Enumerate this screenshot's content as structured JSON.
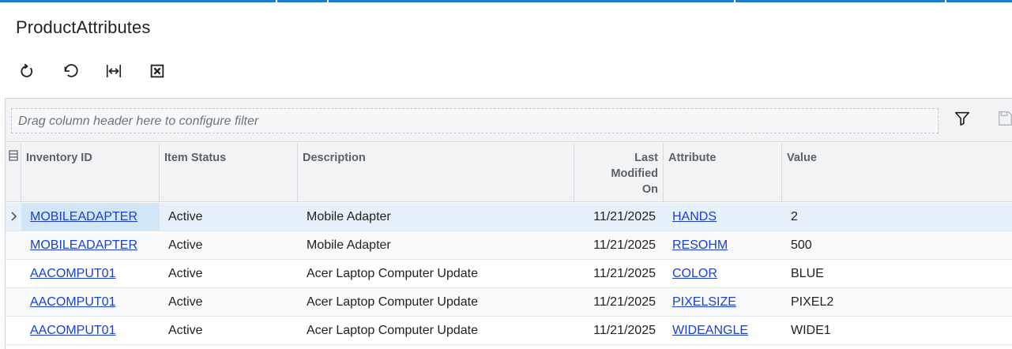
{
  "page": {
    "title": "ProductAttributes"
  },
  "toolbar": {
    "buttons": [
      {
        "name": "refresh-button",
        "icon": "refresh-icon"
      },
      {
        "name": "undo-button",
        "icon": "undo-icon"
      },
      {
        "name": "fit-columns-button",
        "icon": "fit-width-icon"
      },
      {
        "name": "export-excel-button",
        "icon": "excel-icon"
      }
    ]
  },
  "grid": {
    "filter_placeholder": "Drag column header here to configure filter",
    "filter_icon": "filter-icon",
    "save_icon": "save-icon",
    "columns": [
      {
        "key": "inventory_id",
        "label": "Inventory ID"
      },
      {
        "key": "item_status",
        "label": "Item Status"
      },
      {
        "key": "description",
        "label": "Description"
      },
      {
        "key": "last_modified",
        "label": "Last Modified On"
      },
      {
        "key": "attribute",
        "label": "Attribute"
      },
      {
        "key": "value",
        "label": "Value"
      }
    ],
    "rows": [
      {
        "inventory_id": "MOBILEADAPTER",
        "item_status": "Active",
        "description": "Mobile Adapter",
        "last_modified": "11/21/2025",
        "attribute": "HANDS",
        "value": "2"
      },
      {
        "inventory_id": "MOBILEADAPTER",
        "item_status": "Active",
        "description": "Mobile Adapter",
        "last_modified": "11/21/2025",
        "attribute": "RESOHM",
        "value": "500"
      },
      {
        "inventory_id": "AACOMPUT01",
        "item_status": "Active",
        "description": "Acer Laptop Computer Update",
        "last_modified": "11/21/2025",
        "attribute": "COLOR",
        "value": "BLUE"
      },
      {
        "inventory_id": "AACOMPUT01",
        "item_status": "Active",
        "description": "Acer Laptop Computer Update",
        "last_modified": "11/21/2025",
        "attribute": "PIXELSIZE",
        "value": "PIXEL2"
      },
      {
        "inventory_id": "AACOMPUT01",
        "item_status": "Active",
        "description": "Acer Laptop Computer Update",
        "last_modified": "11/21/2025",
        "attribute": "WIDEANGLE",
        "value": "WIDE1"
      }
    ]
  },
  "colors": {
    "accent": "#1a7bc8",
    "link": "#1a3ed6",
    "header_bg": "#f2f3f5",
    "active_row": "#e6f1fb"
  }
}
